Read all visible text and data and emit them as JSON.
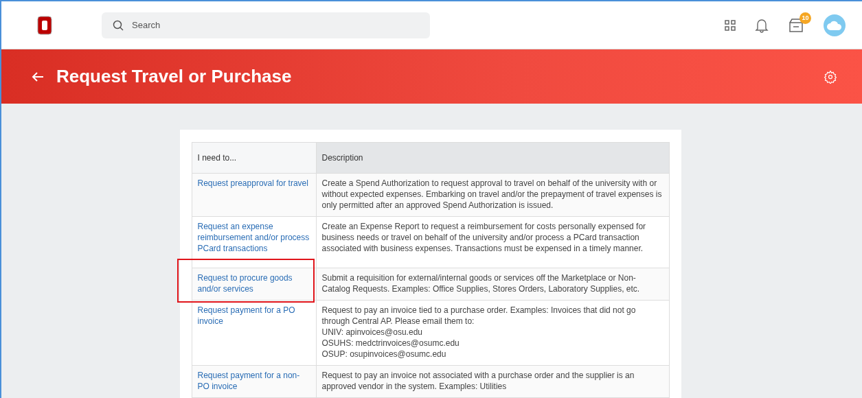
{
  "search": {
    "placeholder": "Search"
  },
  "inbox_badge": "10",
  "page_title": "Request Travel or Purchase",
  "table": {
    "columns": [
      "I need to...",
      "Description"
    ],
    "rows": [
      {
        "action": "Request preapproval for travel",
        "description": [
          "Create a Spend Authorization to request approval to travel on behalf of the university with or without expected expenses. Embarking on travel and/or the prepayment of travel expenses is only permitted after an approved Spend Authorization is issued."
        ],
        "highlighted": false
      },
      {
        "action": "Request an expense reimbursement and/or process PCard transactions",
        "description": [
          "Create an Expense Report to request a reimbursement for costs personally expensed for business needs or travel on behalf of the university and/or process a PCard transaction associated with business expenses. Transactions must be expensed in a timely manner."
        ],
        "highlighted": false
      },
      {
        "action": "Request to procure goods and/or services",
        "description": [
          "Submit a requisition for external/internal goods or services off the Marketplace or Non-Catalog Requests. Examples: Office Supplies, Stores Orders, Laboratory Supplies, etc."
        ],
        "highlighted": true
      },
      {
        "action": "Request payment for a PO invoice",
        "description": [
          "Request to pay an invoice tied to a purchase order. Examples: Invoices that did not go through Central AP. Please email them to:",
          "UNIV: apinvoices@osu.edu",
          "OSUHS: medctrinvoices@osumc.edu",
          "OSUP: osupinvoices@osumc.edu"
        ],
        "highlighted": false
      },
      {
        "action": "Request payment for a non-PO invoice",
        "description": [
          "Request to pay an invoice not associated with a purchase order and the supplier is an approved vendor in the system. Examples: Utilities"
        ],
        "highlighted": false
      }
    ]
  }
}
